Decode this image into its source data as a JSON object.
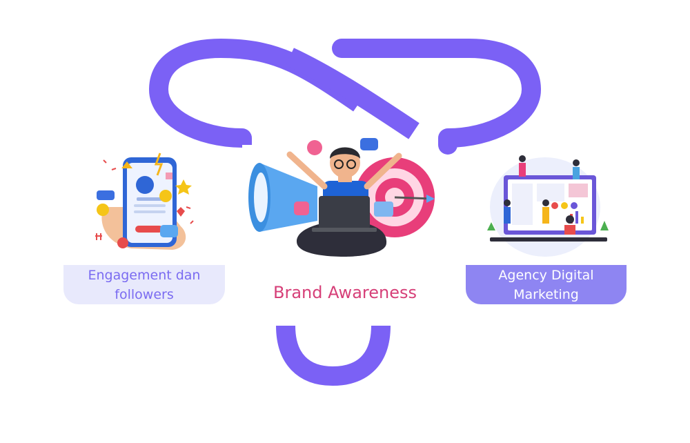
{
  "labels": {
    "left": "Engagement dan followers",
    "center": "Brand Awareness",
    "right": "Agency Digital Marketing"
  },
  "icons": {
    "left": "social-engagement-phone-illustration",
    "center": "megaphone-laptop-target-illustration",
    "right": "digital-marketing-dashboard-illustration"
  },
  "colors": {
    "connector": "#7b61f5",
    "left_box": "#e8e9fc",
    "left_text": "#7a6bf1",
    "right_box": "#8e85f2",
    "right_text": "#ffffff",
    "center_text": "#d63f78"
  }
}
